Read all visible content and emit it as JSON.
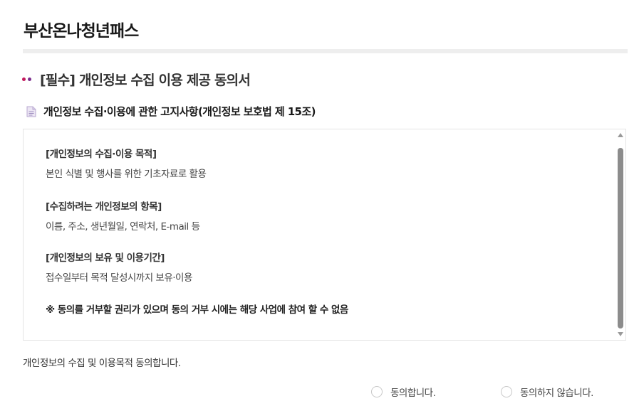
{
  "page": {
    "title": "부산온나청년패스"
  },
  "section": {
    "title": "[필수] 개인정보 수집 이용 제공 동의서",
    "dot_colors": [
      "#c2185b",
      "#7b2c8c"
    ]
  },
  "notice": {
    "icon": "document-icon",
    "title": "개인정보 수집·이용에 관한 고지사항(개인정보 보호법 제 15조)"
  },
  "terms": {
    "blocks": [
      {
        "heading": "[개인정보의 수집·이용 목적]",
        "body": "본인 식별 및 행사를 위한 기초자료로 활용"
      },
      {
        "heading": "[수집하려는 개인정보의 항목]",
        "body": "이름, 주소, 생년월일, 연락처, E-mail 등"
      },
      {
        "heading": "[개인정보의 보유 및 이용기간]",
        "body": "접수일부터 목적 달성시까지 보유·이용"
      }
    ],
    "warning": "※ 동의를 거부할 권리가 있으며 동의 거부 시에는 해당 사업에 참여 할 수 없음"
  },
  "consent": {
    "question": "개인정보의 수집 및 이용목적 동의합니다.",
    "options": [
      {
        "label": "동의합니다.",
        "selected": false
      },
      {
        "label": "동의하지 않습니다.",
        "selected": false
      }
    ]
  }
}
